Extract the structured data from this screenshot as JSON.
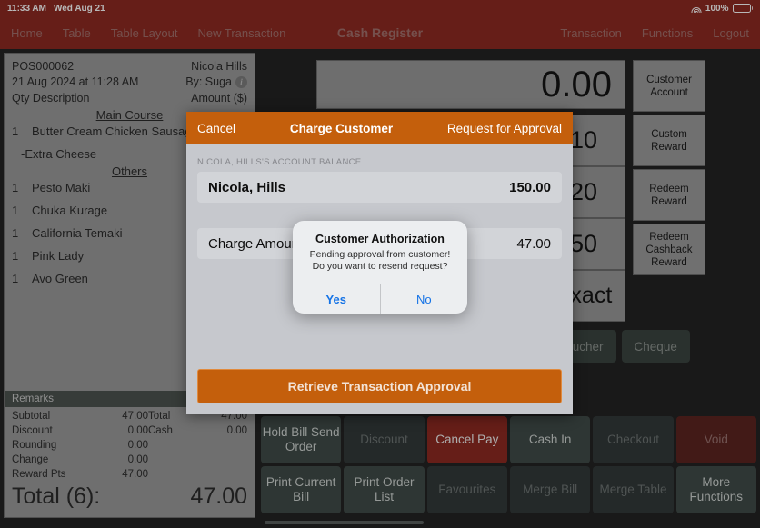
{
  "statusbar": {
    "time": "11:33 AM",
    "date": "Wed Aug 21",
    "battery_percent": "100%",
    "wifi_icon": "wifi-icon",
    "battery_icon": "battery-full-icon"
  },
  "navbar": {
    "title": "Cash Register",
    "left_items": [
      {
        "label": "Home"
      },
      {
        "label": "Table"
      },
      {
        "label": "Table Layout"
      },
      {
        "label": "New Transaction"
      }
    ],
    "right_items": [
      {
        "label": "Transaction"
      },
      {
        "label": "Functions"
      },
      {
        "label": "Logout"
      }
    ]
  },
  "receipt": {
    "pos_id": "POS000062",
    "customer": "Nicola Hills",
    "datetime": "21 Aug 2024 at 11:28 AM",
    "staff": "By: Suga",
    "info_icon": "info-circle-icon",
    "col_qty": "Qty  Description",
    "col_amount": "Amount ($)",
    "sections": [
      {
        "title": "Main Course",
        "items": [
          {
            "qty": "1",
            "desc": "Butter Cream Chicken Sausage",
            "modifier": "-Extra Cheese"
          }
        ]
      },
      {
        "title": "Others",
        "items": [
          {
            "qty": "1",
            "desc": "Pesto Maki"
          },
          {
            "qty": "1",
            "desc": "Chuka Kurage"
          },
          {
            "qty": "1",
            "desc": "California Temaki"
          },
          {
            "qty": "1",
            "desc": "Pink Lady"
          },
          {
            "qty": "1",
            "desc": "Avo Green"
          }
        ]
      }
    ],
    "remarks_label": "Remarks",
    "totals_left": [
      {
        "label": "Subtotal",
        "value": "47.00"
      },
      {
        "label": "Discount",
        "value": "0.00"
      },
      {
        "label": "Rounding",
        "value": "0.00"
      },
      {
        "label": "Change",
        "value": "0.00"
      },
      {
        "label": "Reward Pts",
        "value": "47.00"
      }
    ],
    "totals_right": [
      {
        "label": "Total",
        "value": "47.00"
      },
      {
        "label": "Cash",
        "value": "0.00"
      }
    ],
    "grand_label": "Total (6):",
    "grand_value": "47.00"
  },
  "register": {
    "amount_display": "0.00",
    "quick_amounts": [
      {
        "label": "10"
      },
      {
        "label": "20"
      },
      {
        "label": "50"
      },
      {
        "label": "Exact"
      }
    ],
    "side_buttons": [
      {
        "label": "Customer Account"
      },
      {
        "label": "Custom Reward"
      },
      {
        "label": "Redeem Reward"
      },
      {
        "label": "Redeem Cashback Reward"
      }
    ],
    "payment_buttons": [
      {
        "label": "Voucher"
      },
      {
        "label": "Cheque"
      }
    ]
  },
  "bottom_buttons": {
    "row1": [
      {
        "label": "Hold Bill Send Order",
        "style": "active"
      },
      {
        "label": "Discount",
        "style": "dim"
      },
      {
        "label": "Cancel Pay",
        "style": "danger"
      },
      {
        "label": "Cash In",
        "style": "active"
      },
      {
        "label": "Checkout",
        "style": "dim"
      },
      {
        "label": "Void",
        "style": "danger-dim"
      }
    ],
    "row2": [
      {
        "label": "Print Current Bill",
        "style": "active"
      },
      {
        "label": "Print Order List",
        "style": "active"
      },
      {
        "label": "Favourites",
        "style": "dim"
      },
      {
        "label": "Merge Bill",
        "style": "dim"
      },
      {
        "label": "Merge Table",
        "style": "dim"
      },
      {
        "label": "More Functions",
        "style": "active"
      }
    ]
  },
  "modal": {
    "cancel_label": "Cancel",
    "title": "Charge Customer",
    "request_label": "Request for Approval",
    "balance_section_label": "Nicola, Hills's Account Balance",
    "balance_name": "Nicola, Hills",
    "balance_value": "150.00",
    "charge_label": "Charge Amount",
    "charge_value": "47.00",
    "retrieve_label": "Retrieve Transaction Approval"
  },
  "alert": {
    "title": "Customer Authorization",
    "message": "Pending approval from customer! Do you want to resend request?",
    "yes_label": "Yes",
    "no_label": "No"
  },
  "colors": {
    "brand_red": "#8e2a22",
    "accent_orange": "#c45f0c",
    "link_blue": "#1573e6"
  }
}
